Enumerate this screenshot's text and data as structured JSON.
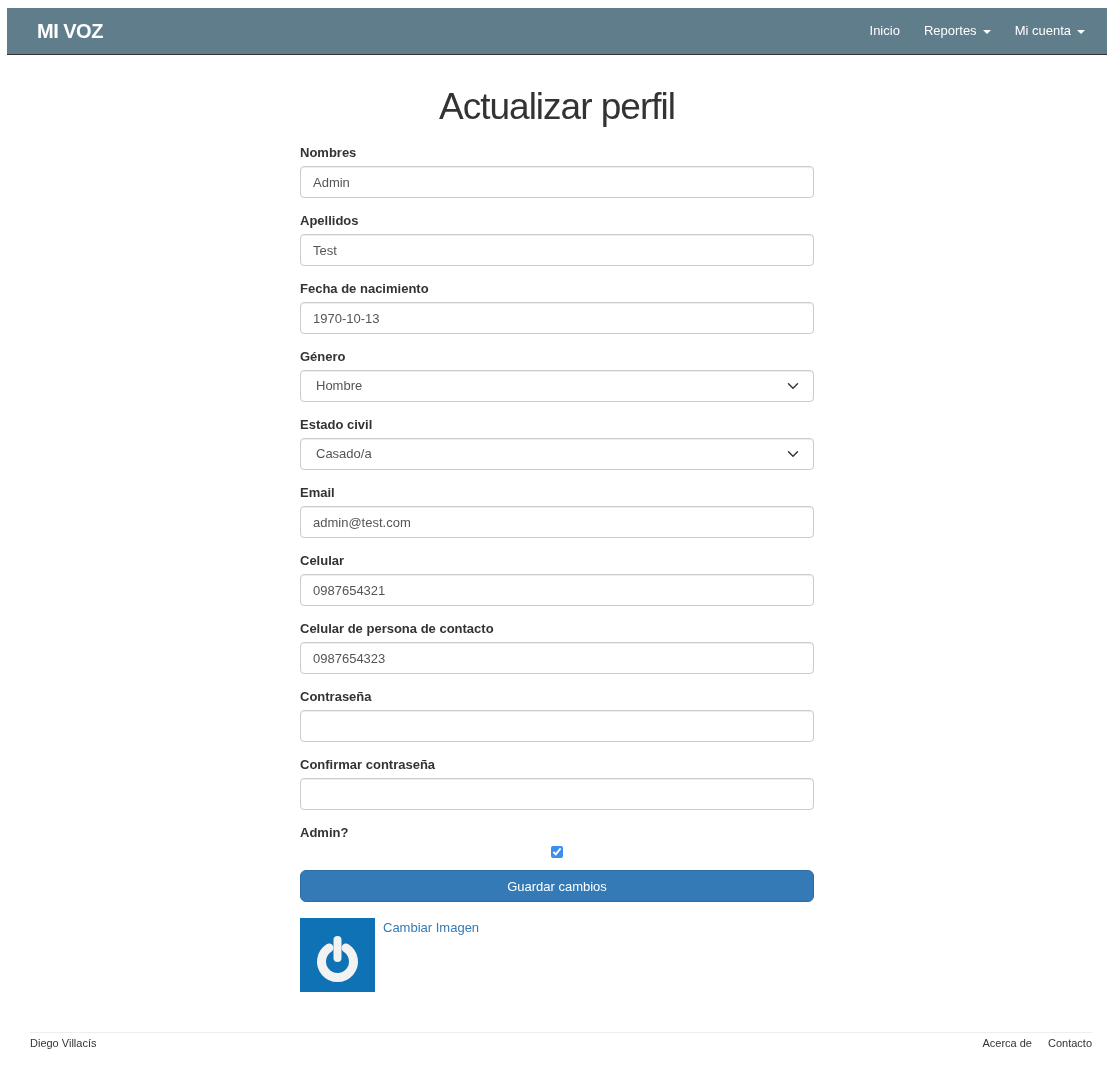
{
  "navbar": {
    "brand": "MI VOZ",
    "links": [
      {
        "label": "Inicio",
        "dropdown": false
      },
      {
        "label": "Reportes",
        "dropdown": true
      },
      {
        "label": "Mi cuenta",
        "dropdown": true
      }
    ]
  },
  "title": "Actualizar perfil",
  "fields": [
    {
      "kind": "text",
      "label": "Nombres",
      "value": "Admin"
    },
    {
      "kind": "text",
      "label": "Apellidos",
      "value": "Test"
    },
    {
      "kind": "text",
      "label": "Fecha de nacimiento",
      "value": "1970-10-13"
    },
    {
      "kind": "select",
      "label": "Género",
      "value": "Hombre"
    },
    {
      "kind": "select",
      "label": "Estado civil",
      "value": "Casado/a"
    },
    {
      "kind": "text",
      "label": "Email",
      "value": "admin@test.com"
    },
    {
      "kind": "text",
      "label": "Celular",
      "value": "0987654321"
    },
    {
      "kind": "text",
      "label": "Celular de persona de contacto",
      "value": "0987654323"
    },
    {
      "kind": "password",
      "label": "Contraseña"
    },
    {
      "kind": "password",
      "label": "Confirmar contraseña"
    },
    {
      "kind": "checkbox",
      "label": "Admin?",
      "checked": true
    }
  ],
  "submit": "Guardar cambios",
  "image_link": "Cambiar Imagen",
  "footer": {
    "author": "Diego Villacís",
    "links": [
      "Acerca de",
      "Contacto"
    ]
  }
}
